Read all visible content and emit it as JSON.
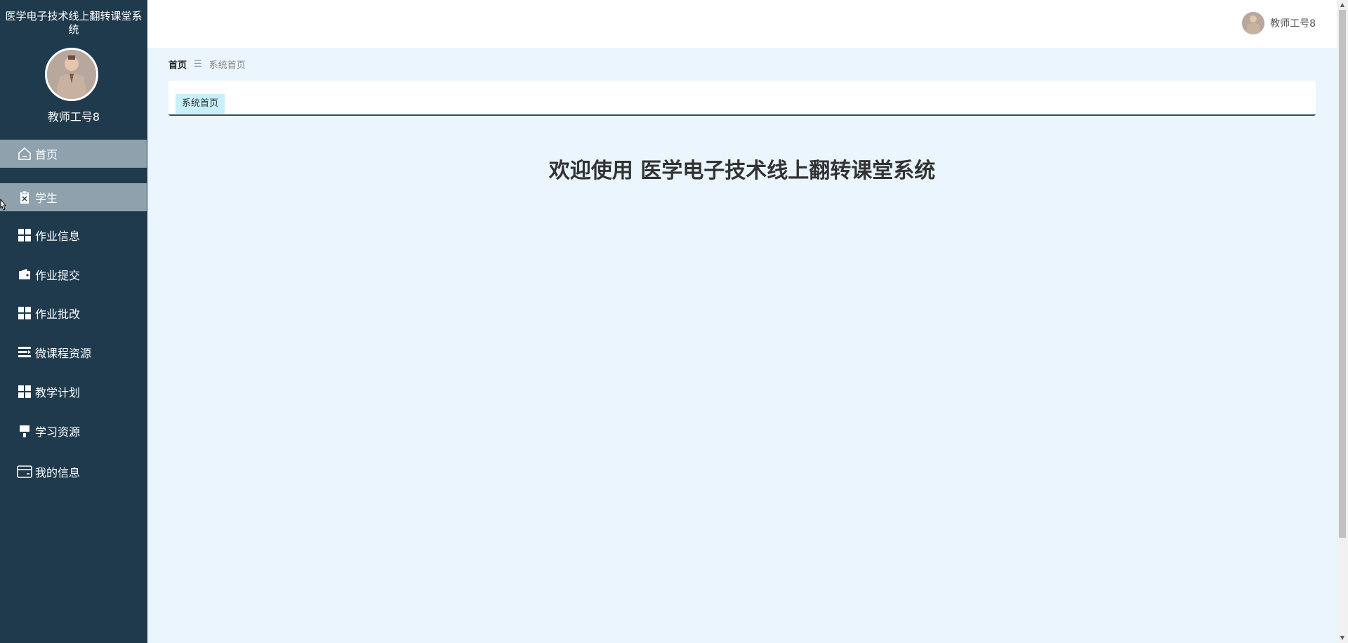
{
  "app": {
    "title": "医学电子技术线上翻转课堂系统",
    "username": "教师工号8"
  },
  "menu": [
    {
      "label": "首页",
      "icon": "home-icon"
    },
    {
      "label": "学生",
      "icon": "clipboard-icon"
    },
    {
      "label": "作业信息",
      "icon": "grid-icon"
    },
    {
      "label": "作业提交",
      "icon": "wallet-icon"
    },
    {
      "label": "作业批改",
      "icon": "grid-icon"
    },
    {
      "label": "微课程资源",
      "icon": "list-icon"
    },
    {
      "label": "教学计划",
      "icon": "grid-icon"
    },
    {
      "label": "学习资源",
      "icon": "brush-icon"
    },
    {
      "label": "我的信息",
      "icon": "card-icon"
    }
  ],
  "header": {
    "username": "教师工号8"
  },
  "breadcrumb": {
    "home": "首页",
    "separator": "☰",
    "current": "系统首页"
  },
  "tabs": [
    {
      "label": "系统首页"
    }
  ],
  "main": {
    "welcome": "欢迎使用 医学电子技术线上翻转课堂系统"
  },
  "colors": {
    "sidebar_bg": "#1f3a4d",
    "menu_highlight": "#8ea1ad",
    "content_bg": "#eaf5fd",
    "tab_bg": "#c7f0fb"
  }
}
